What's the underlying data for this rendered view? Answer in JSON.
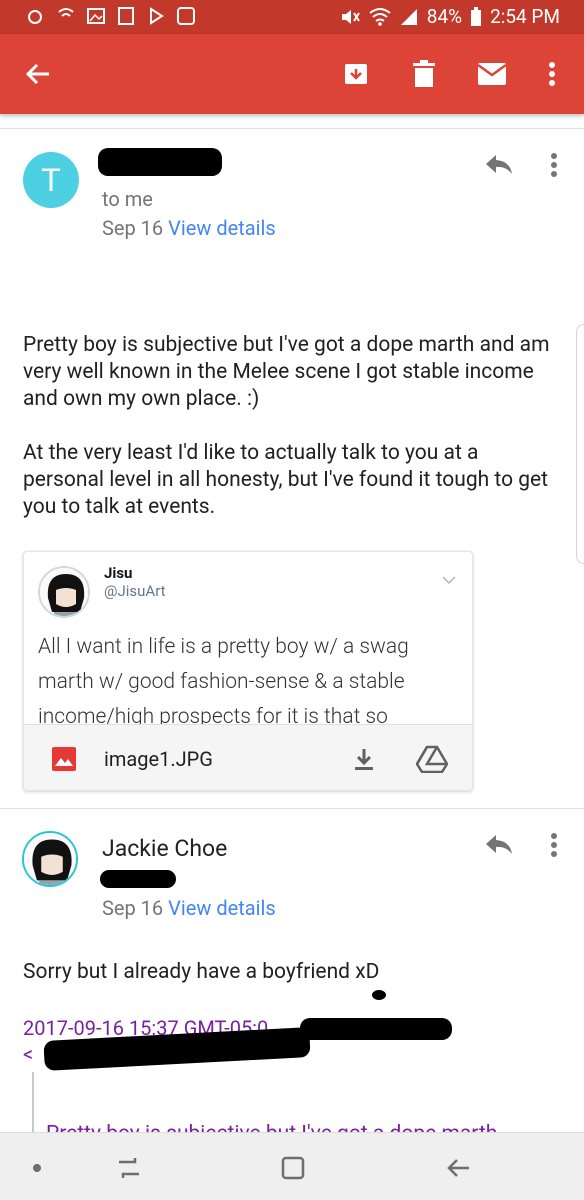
{
  "status": {
    "battery": "84%",
    "time": "2:54 PM"
  },
  "appbar": {
    "back": "back-arrow-icon",
    "actions": [
      "archive-icon",
      "delete-icon",
      "mark-unread-icon",
      "overflow-menu-icon"
    ]
  },
  "message1": {
    "avatar_letter": "T",
    "to": "to me",
    "date": "Sep 16",
    "details_link": "View details",
    "paragraph1": "Pretty boy is subjective but I've got a dope marth and am very well known in the Melee scene I got stable income and own my own place.  :)",
    "paragraph2": "At the very least I'd like to actually talk to you at a personal level in all honesty, but I've found it tough to get you to talk at events.",
    "tweet": {
      "name": "Jisu",
      "handle": "@JisuArt",
      "text": "All I want in life is a pretty boy w/ a swag marth w/ good fashion-sense & a stable income/high prospects for it is that so"
    },
    "attachment": {
      "filename": "image1.JPG"
    }
  },
  "message2": {
    "sender": "Jackie Choe",
    "date": "Sep 16",
    "details_link": "View details",
    "body": "Sorry but I already have a boyfriend xD",
    "quote_header": "2017-09-16 15:37 GMT-05:0",
    "quote_header2": "<",
    "quoted_preview": "Pretty boy is subjective but I've got a dope marth"
  },
  "colors": {
    "accent_red": "#db4437",
    "status_red": "#c2382b",
    "link_blue": "#4285f4",
    "avatar_cyan": "#4dd0e1",
    "quote_purple": "#7b1fa2"
  }
}
